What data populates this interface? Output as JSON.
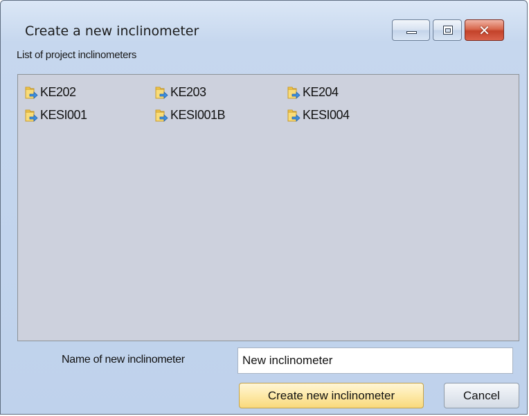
{
  "window": {
    "title": "Create a new inclinometer",
    "close_glyph": "✕"
  },
  "list": {
    "label": "List of project inclinometers",
    "items": [
      {
        "label": "KE202",
        "icon": "folder-shortcut-icon"
      },
      {
        "label": "KE203",
        "icon": "folder-shortcut-icon"
      },
      {
        "label": "KE204",
        "icon": "folder-shortcut-icon"
      },
      {
        "label": "KESI001",
        "icon": "folder-shortcut-icon"
      },
      {
        "label": "KESI001B",
        "icon": "folder-shortcut-icon"
      },
      {
        "label": "KESI004",
        "icon": "folder-shortcut-icon"
      }
    ]
  },
  "form": {
    "name_label": "Name of new inclinometer",
    "name_value": "New inclinometer"
  },
  "buttons": {
    "create_label": "Create new inclinometer",
    "cancel_label": "Cancel"
  },
  "colors": {
    "window_bg": "#bfd2ec",
    "list_bg": "#cdd1dd",
    "create_button": "#fde9a8",
    "close_button": "#c3422a"
  }
}
